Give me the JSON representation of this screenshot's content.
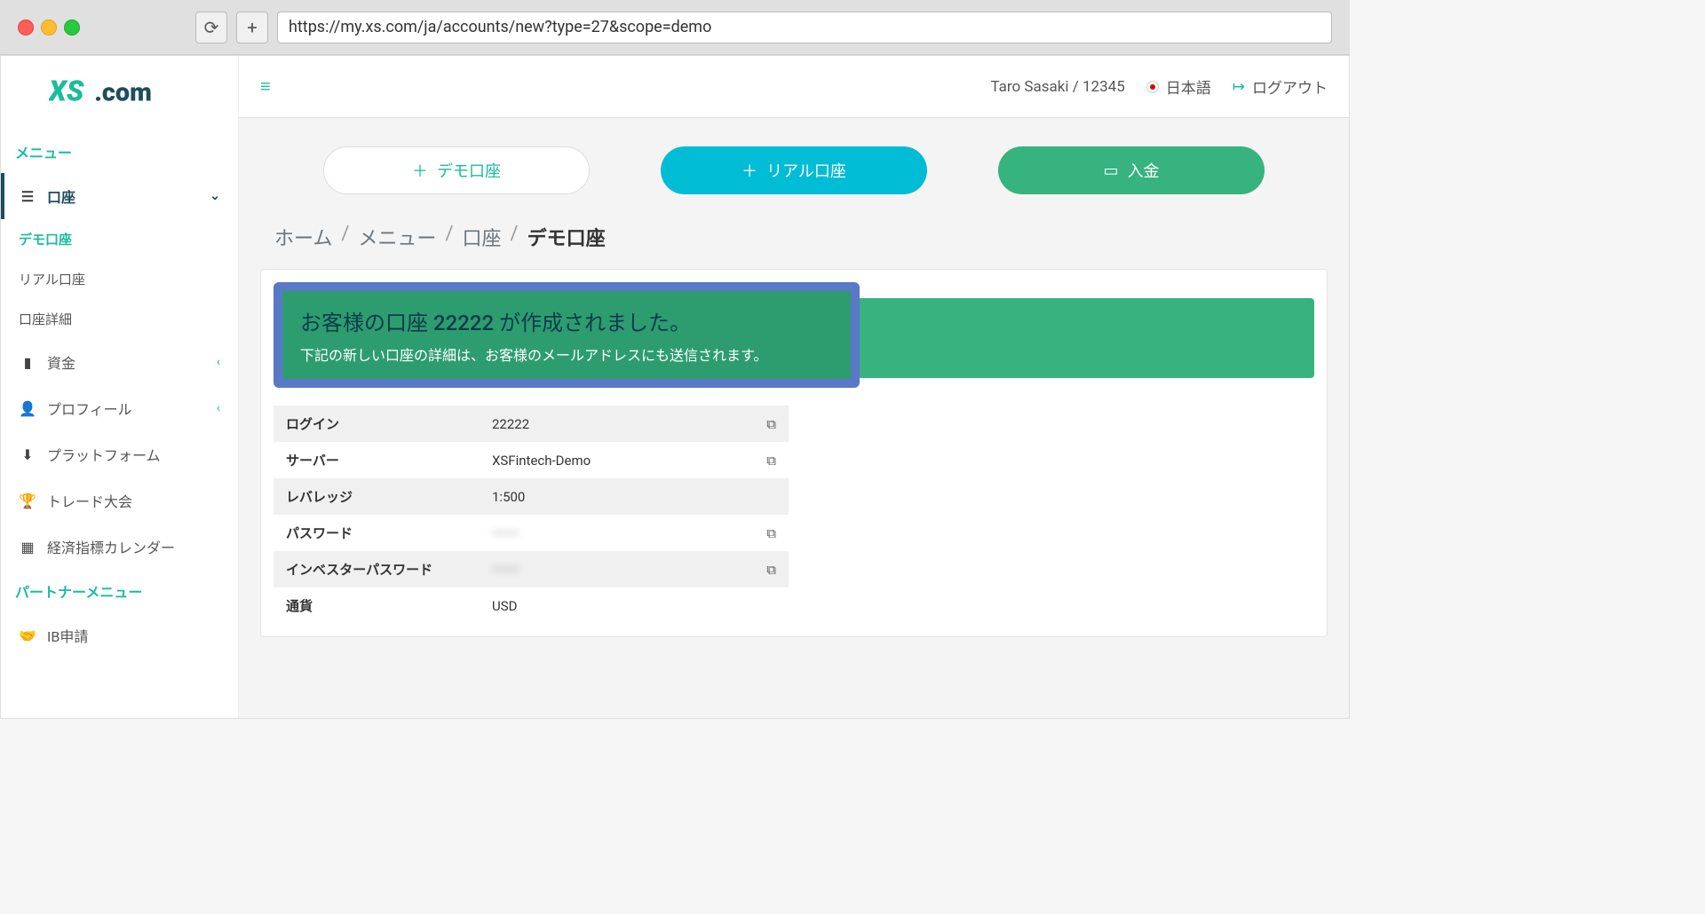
{
  "url": "https://my.xs.com/ja/accounts/new?type=27&scope=demo",
  "logo_text": "XS.com",
  "sidebar": {
    "menu_header": "メニュー",
    "accounts": "口座",
    "sub": {
      "demo": "デモ口座",
      "real": "リアル口座",
      "detail": "口座詳細"
    },
    "funds": "資金",
    "profile": "プロフィール",
    "platform": "プラットフォーム",
    "contest": "トレード大会",
    "calendar": "経済指標カレンダー",
    "partner_header": "パートナーメニュー",
    "ib": "IB申請"
  },
  "header": {
    "user": "Taro Sasaki / 12345",
    "language": "日本語",
    "logout": "ログアウト"
  },
  "actions": {
    "demo": "デモ口座",
    "real": "リアル口座",
    "deposit": "入金"
  },
  "breadcrumb": {
    "home": "ホーム",
    "menu": "メニュー",
    "accounts": "口座",
    "current": "デモ口座"
  },
  "banner": {
    "title": "お客様の口座 22222 が作成されました。",
    "sub": "下記の新しい口座の詳細は、お客様のメールアドレスにも送信されます。"
  },
  "table": {
    "login_lbl": "ログイン",
    "login_val": "22222",
    "server_lbl": "サーバー",
    "server_val": "XSFintech-Demo",
    "leverage_lbl": "レバレッジ",
    "leverage_val": "1:500",
    "password_lbl": "パスワード",
    "password_val": "••••••",
    "investor_lbl": "インベスターパスワード",
    "investor_val": "••••••",
    "currency_lbl": "通貨",
    "currency_val": "USD"
  }
}
